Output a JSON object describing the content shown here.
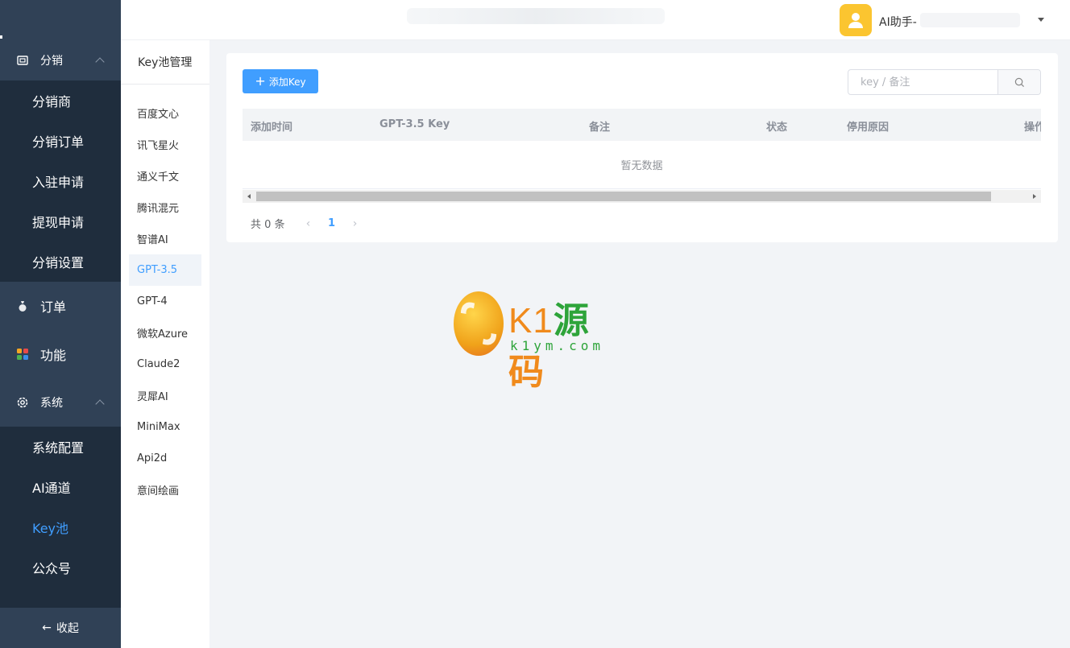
{
  "sidebar": {
    "groups": [
      {
        "label": "分销",
        "icon": "wallet-icon",
        "expanded": true,
        "items": [
          "分销商",
          "分销订单",
          "入驻申请",
          "提现申请",
          "分销设置"
        ]
      },
      {
        "label": "订单",
        "icon": "money-bag-icon"
      },
      {
        "label": "功能",
        "icon": "apps-icon"
      },
      {
        "label": "系统",
        "icon": "gear-icon",
        "expanded": true,
        "items": [
          "系统配置",
          "AI通道",
          "Key池",
          "公众号"
        ],
        "active_item": "Key池"
      }
    ],
    "collapse_label": "收起"
  },
  "header": {
    "user_name": "AI助手-"
  },
  "subnav": {
    "title": "Key池管理",
    "items": [
      "百度文心",
      "讯飞星火",
      "通义千文",
      "腾讯混元",
      "智谱AI",
      "GPT-3.5",
      "GPT-4",
      "微软Azure",
      "Claude2",
      "灵犀AI",
      "MiniMax",
      "Api2d",
      "意间绘画"
    ],
    "active": "GPT-3.5"
  },
  "toolbar": {
    "add_label": "添加Key",
    "search_placeholder": "key / 备注"
  },
  "table": {
    "columns": [
      "添加时间",
      "GPT-3.5 Key",
      "备注",
      "状态",
      "停用原因",
      "操作"
    ],
    "empty_text": "暂无数据"
  },
  "pagination": {
    "total_text": "共 0 条",
    "current_page": "1"
  },
  "watermark": {
    "brand_k1": "K1",
    "brand_yuan": "源",
    "brand_ma": "码",
    "url": "k1ym.com"
  },
  "colors": {
    "accent": "#409eff",
    "sidebar_bg": "#1f2d3d",
    "sidebar_head_bg": "#304156",
    "avatar": "#fbc530"
  }
}
